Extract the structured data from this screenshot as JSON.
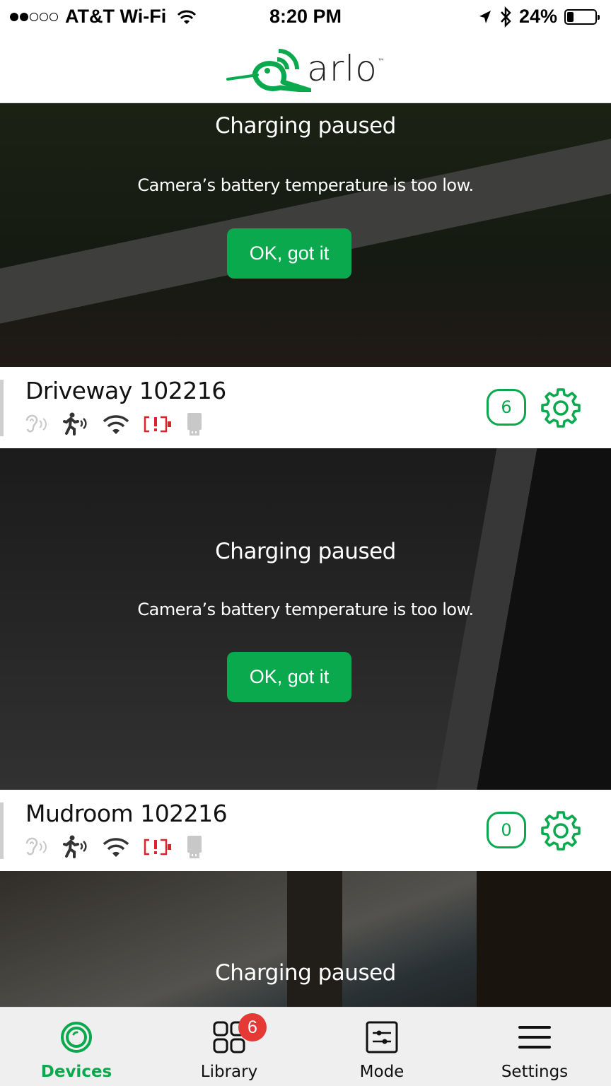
{
  "status_bar": {
    "signal_strength": 2,
    "signal_max": 5,
    "carrier": "AT&T Wi-Fi",
    "time": "8:20 PM",
    "battery_percent_label": "24%",
    "battery_level": 0.24,
    "icons": [
      "wifi-icon",
      "location-arrow-icon",
      "bluetooth-icon",
      "battery-icon"
    ]
  },
  "header": {
    "logo_text": "arlo",
    "logo_trademark": "™",
    "brand_color": "#0aa94e"
  },
  "cameras": [
    {
      "name": "Driveway 102216",
      "alert_title": "Charging paused",
      "alert_message": "Camera’s battery temperature is too low.",
      "alert_button": "OK, got it",
      "clip_count": "6",
      "status_icons": [
        "audio-ear-icon",
        "motion-icon",
        "wifi-signal-icon",
        "battery-alert-icon",
        "usb-storage-icon"
      ]
    },
    {
      "name": "Mudroom 102216",
      "alert_title": "Charging paused",
      "alert_message": "Camera’s battery temperature is too low.",
      "alert_button": "OK, got it",
      "clip_count": "0",
      "status_icons": [
        "audio-ear-icon",
        "motion-icon",
        "wifi-signal-icon",
        "battery-alert-icon",
        "usb-storage-icon"
      ]
    },
    {
      "alert_title": "Charging paused"
    }
  ],
  "tab_bar": {
    "tabs": [
      {
        "label": "Devices",
        "icon": "devices-camera-icon",
        "active": true
      },
      {
        "label": "Library",
        "icon": "library-grid-icon",
        "badge": "6"
      },
      {
        "label": "Mode",
        "icon": "mode-sliders-icon"
      },
      {
        "label": "Settings",
        "icon": "menu-icon"
      }
    ]
  },
  "colors": {
    "accent_green": "#0aa94e",
    "alert_red": "#e0202e",
    "badge_red": "#e53935"
  }
}
